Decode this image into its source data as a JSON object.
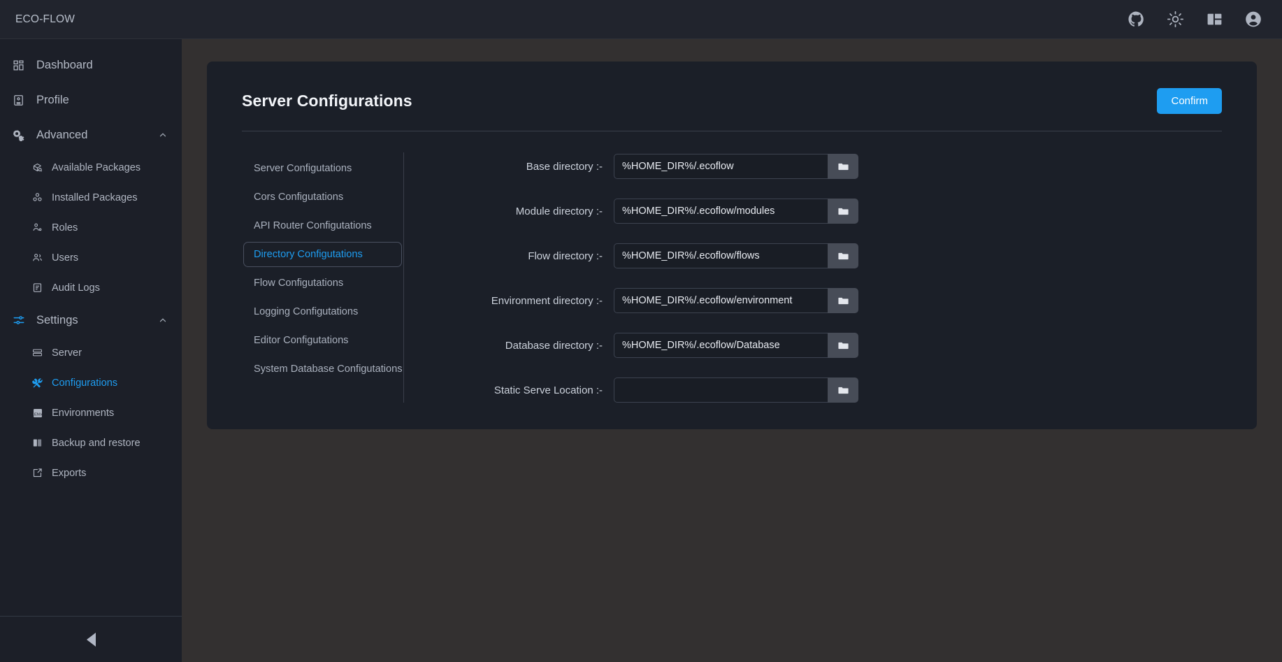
{
  "app": {
    "brand": "ECO-FLOW",
    "colors": {
      "accent": "#1e9df1",
      "sidebar_bg": "#1c1f28",
      "topbar_bg": "#21242d",
      "page_bg": "#333030",
      "card_bg": "#1b1f28",
      "text": "#b4bac6"
    }
  },
  "topbar": {
    "icons": [
      {
        "name": "github-icon",
        "title": "GitHub"
      },
      {
        "name": "sun-icon",
        "title": "Toggle light mode"
      },
      {
        "name": "layout-panel-icon",
        "title": "Toggle layout"
      },
      {
        "name": "account-circle-icon",
        "title": "Account"
      }
    ]
  },
  "sidebar": {
    "items": [
      {
        "label": "Dashboard",
        "icon": "dashboard-grid-icon",
        "level": "top",
        "active": false,
        "expandable": false
      },
      {
        "label": "Profile",
        "icon": "id-card-icon",
        "level": "top",
        "active": false,
        "expandable": false
      },
      {
        "label": "Advanced",
        "icon": "advanced-gear-icon",
        "level": "top",
        "active": false,
        "expandable": true,
        "expanded": true
      },
      {
        "label": "Available Packages",
        "icon": "package-search-icon",
        "level": "sub",
        "active": false
      },
      {
        "label": "Installed Packages",
        "icon": "packages-stack-icon",
        "level": "sub",
        "active": false
      },
      {
        "label": "Roles",
        "icon": "user-role-icon",
        "level": "sub",
        "active": false
      },
      {
        "label": "Users",
        "icon": "users-icon",
        "level": "sub",
        "active": false
      },
      {
        "label": "Audit Logs",
        "icon": "audit-log-icon",
        "level": "sub",
        "active": false
      },
      {
        "label": "Settings",
        "icon": "sliders-icon",
        "level": "top",
        "active": false,
        "expandable": true,
        "expanded": true,
        "accent_icon": true
      },
      {
        "label": "Server",
        "icon": "server-icon",
        "level": "sub",
        "active": false
      },
      {
        "label": "Configurations",
        "icon": "tools-icon",
        "level": "sub",
        "active": true,
        "accent_icon": true
      },
      {
        "label": "Environments",
        "icon": "env-file-icon",
        "level": "sub",
        "active": false
      },
      {
        "label": "Backup and restore",
        "icon": "backup-restore-icon",
        "level": "sub",
        "active": false
      },
      {
        "label": "Exports",
        "icon": "export-icon",
        "level": "sub",
        "active": false
      }
    ],
    "collapse_button": "collapse-sidebar-triangle"
  },
  "page": {
    "title": "Server Configurations",
    "confirm_label": "Confirm",
    "tabs": [
      {
        "label": "Server Configutations",
        "active": false
      },
      {
        "label": "Cors Configutations",
        "active": false
      },
      {
        "label": "API Router Configutations",
        "active": false
      },
      {
        "label": "Directory Configutations",
        "active": true
      },
      {
        "label": "Flow Configutations",
        "active": false
      },
      {
        "label": "Logging Configutations",
        "active": false
      },
      {
        "label": "Editor Configutations",
        "active": false
      },
      {
        "label": "System Database Configutations",
        "active": false
      }
    ],
    "fields": [
      {
        "label": "Base directory :-",
        "value": "%HOME_DIR%/.ecoflow",
        "placeholder": "",
        "browse": "folder-icon"
      },
      {
        "label": "Module directory :-",
        "value": "%HOME_DIR%/.ecoflow/modules",
        "placeholder": "",
        "browse": "folder-icon"
      },
      {
        "label": "Flow directory :-",
        "value": "%HOME_DIR%/.ecoflow/flows",
        "placeholder": "",
        "browse": "folder-icon"
      },
      {
        "label": "Environment directory :-",
        "value": "%HOME_DIR%/.ecoflow/environment",
        "placeholder": "",
        "browse": "folder-icon"
      },
      {
        "label": "Database directory :-",
        "value": "%HOME_DIR%/.ecoflow/Database",
        "placeholder": "",
        "browse": "folder-icon"
      },
      {
        "label": "Static Serve Location :-",
        "value": "",
        "placeholder": "",
        "browse": "folder-icon"
      }
    ]
  }
}
